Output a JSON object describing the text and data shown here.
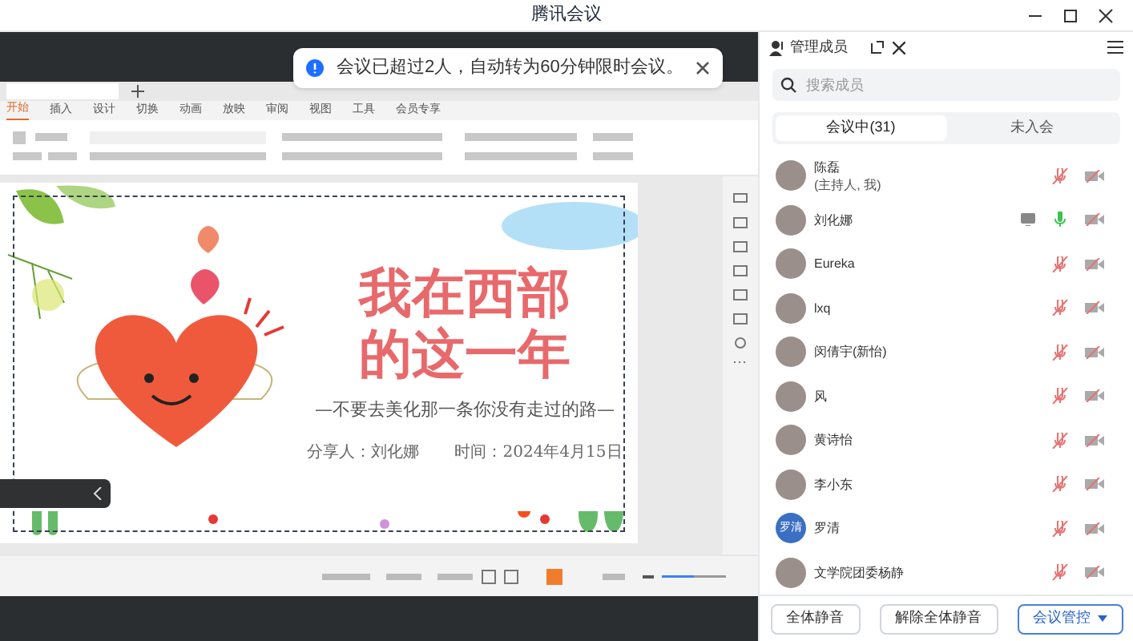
{
  "window": {
    "title": "腾讯会议"
  },
  "toast": {
    "message": "会议已超过2人，自动转为60分钟限时会议。"
  },
  "presentation": {
    "ribbon_tabs": [
      {
        "label": "开始",
        "selected": true
      },
      {
        "label": "插入",
        "selected": false
      },
      {
        "label": "设计",
        "selected": false
      },
      {
        "label": "切换",
        "selected": false
      },
      {
        "label": "动画",
        "selected": false
      },
      {
        "label": "放映",
        "selected": false
      },
      {
        "label": "审阅",
        "selected": false
      },
      {
        "label": "视图",
        "selected": false
      },
      {
        "label": "工具",
        "selected": false
      },
      {
        "label": "会员专享",
        "selected": false
      }
    ],
    "slide": {
      "title_lines": [
        "我在西部",
        "的这一年"
      ],
      "subtitle": "—不要去美化那一条你没有走过的路—",
      "presenter": "分享人：刘化娜",
      "date": "时间：2024年4月15日"
    }
  },
  "panel": {
    "title": "管理成员",
    "search": {
      "placeholder": "搜索成员"
    },
    "tabs": [
      {
        "label": "会议中(31)",
        "selected": true
      },
      {
        "label": "未入会",
        "selected": false
      }
    ],
    "members": [
      {
        "name": "陈磊",
        "role": "(主持人, 我)",
        "mic_on": false,
        "sharing": false
      },
      {
        "name": "刘化娜",
        "mic_on": true,
        "sharing": true
      },
      {
        "name": "Eureka",
        "mic_on": false,
        "sharing": false
      },
      {
        "name": "lxq",
        "mic_on": false,
        "sharing": false
      },
      {
        "name": "闵倩宇(新怡)",
        "mic_on": false,
        "sharing": false
      },
      {
        "name": "风",
        "mic_on": false,
        "sharing": false
      },
      {
        "name": "黄诗怡",
        "mic_on": false,
        "sharing": false
      },
      {
        "name": "李小东",
        "mic_on": false,
        "sharing": false
      },
      {
        "name": "罗清",
        "avatar_text": "罗清",
        "mic_on": false,
        "sharing": false
      },
      {
        "name": "文学院团委杨静",
        "mic_on": false,
        "sharing": false
      }
    ],
    "buttons": [
      {
        "label": "全体静音",
        "kind": "plain"
      },
      {
        "label": "解除全体静音",
        "kind": "plain"
      },
      {
        "label": "会议管控",
        "kind": "menu"
      }
    ]
  }
}
